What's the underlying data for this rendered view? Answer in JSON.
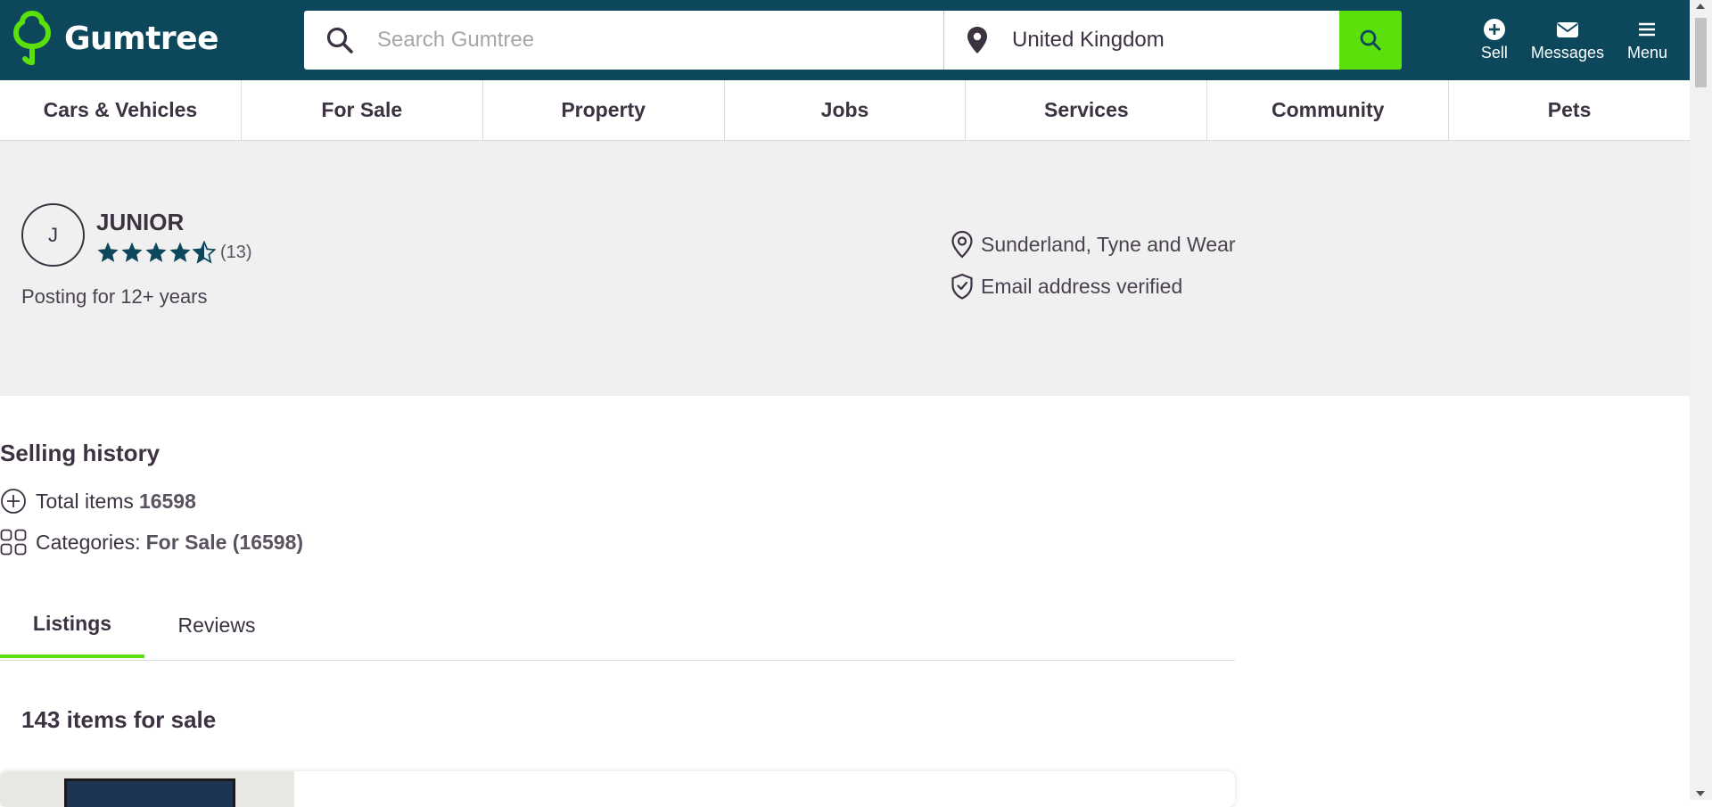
{
  "header": {
    "logo_text": "Gumtree",
    "search_placeholder": "Search Gumtree",
    "location_value": "United Kingdom",
    "actions": [
      {
        "label": "Sell",
        "icon": "plus-circle-icon"
      },
      {
        "label": "Messages",
        "icon": "envelope-icon"
      },
      {
        "label": "Menu",
        "icon": "hamburger-icon"
      }
    ]
  },
  "categories": [
    "Cars & Vehicles",
    "For Sale",
    "Property",
    "Jobs",
    "Services",
    "Community",
    "Pets"
  ],
  "profile": {
    "avatar_initial": "J",
    "name": "JUNIOR",
    "rating_stars": 4.5,
    "rating_count": "(13)",
    "posting": "Posting for 12+ years",
    "location": "Sunderland, Tyne and Wear",
    "verified": "Email address verified"
  },
  "selling_history": {
    "title": "Selling history",
    "total_label": "Total items",
    "total_value": "16598",
    "categories_label": "Categories:",
    "categories_value": "For Sale (16598)"
  },
  "tabs": [
    "Listings",
    "Reviews"
  ],
  "listings": {
    "count_text": "143 items for sale"
  },
  "colors": {
    "brand_dark": "#0d475c",
    "brand_green": "#5ce00b",
    "text": "#3c3241"
  }
}
